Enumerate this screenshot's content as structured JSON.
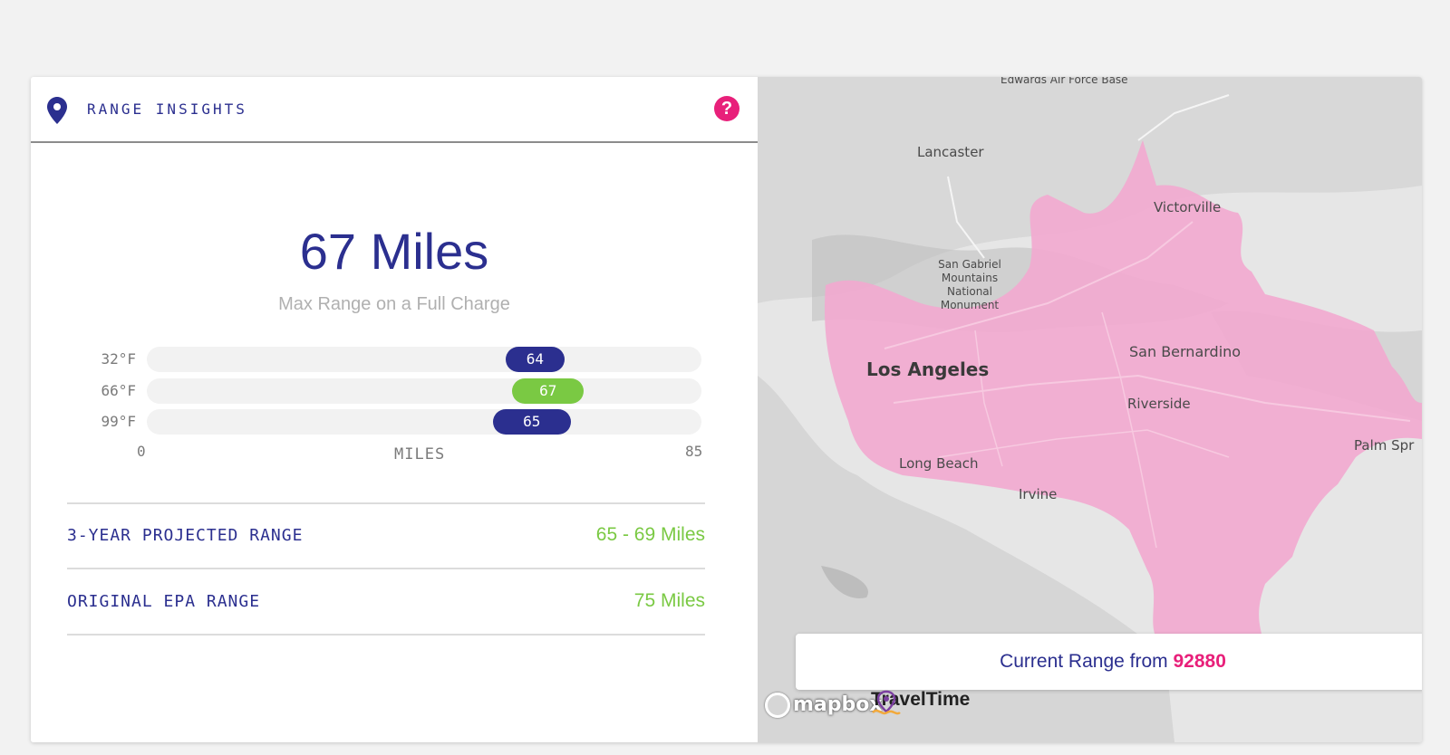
{
  "header": {
    "title": "RANGE INSIGHTS",
    "help_icon": "help-icon",
    "location_icon": "location-pin-icon"
  },
  "range": {
    "value": "67 Miles",
    "subtitle": "Max Range on a Full Charge"
  },
  "chart_data": {
    "type": "bar",
    "categories": [
      "32°F",
      "66°F",
      "99°F"
    ],
    "series": [
      {
        "values": [
          64,
          67,
          65
        ]
      }
    ],
    "bar_starts": [
      55,
      56,
      53
    ],
    "xlabel": "MILES",
    "xlim": [
      0,
      85
    ],
    "tick_labels": [
      "0",
      "85"
    ],
    "colors": [
      "#2b2f8f",
      "#7ac943",
      "#2b2f8f"
    ]
  },
  "stats": [
    {
      "label": "3-YEAR PROJECTED RANGE",
      "value": "65 - 69 Miles"
    },
    {
      "label": "ORIGINAL EPA RANGE",
      "value": "75 Miles"
    }
  ],
  "map": {
    "labels": [
      "Edwards Air Force Base",
      "Lancaster",
      "Victorville",
      "San Gabriel Mountains National Monument",
      "Los Angeles",
      "San Bernardino",
      "Riverside",
      "Long Beach",
      "Irvine",
      "Palm Spr"
    ],
    "range_prefix": "Current Range from",
    "zip": "92880",
    "attribution": [
      "mapbox",
      "TravelTime"
    ]
  },
  "colors": {
    "accent": "#2b2f8f",
    "green": "#7ac943",
    "pink": "#e8207a",
    "isochrone": "#f2a7cf"
  }
}
